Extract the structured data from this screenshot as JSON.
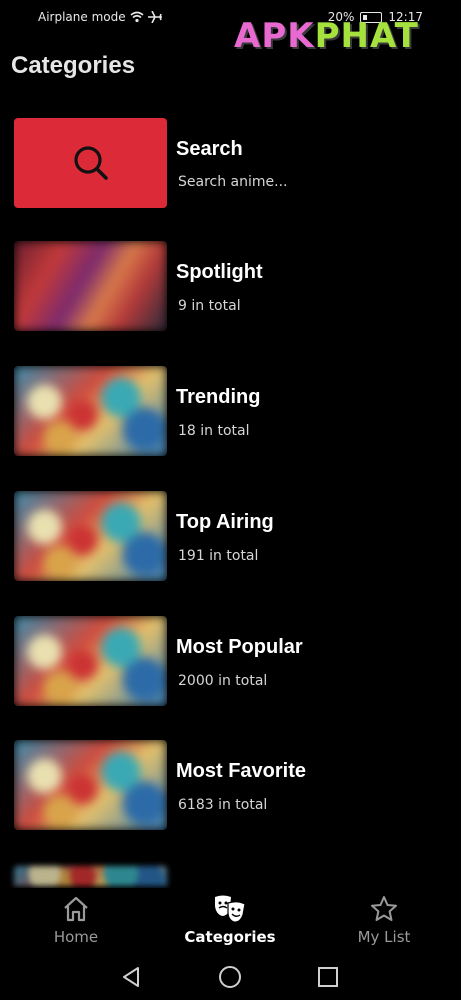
{
  "status_bar": {
    "left_text": "Airplane mode",
    "battery_percent": "20%",
    "time": "12:17"
  },
  "watermark": {
    "text_a": "APK",
    "text_b": "PHAT"
  },
  "page": {
    "title": "Categories"
  },
  "colors": {
    "background": "#000000",
    "search_tile": "#dc2a39",
    "text_primary": "#ffffff",
    "text_secondary": "#d6d6d6",
    "nav_inactive": "#9a9a9a"
  },
  "categories": [
    {
      "title": "Search",
      "subtitle": "Search anime...",
      "icon": "search-icon"
    },
    {
      "title": "Spotlight",
      "subtitle": "9 in total"
    },
    {
      "title": "Trending",
      "subtitle": "18 in total"
    },
    {
      "title": "Top Airing",
      "subtitle": "191 in total"
    },
    {
      "title": "Most Popular",
      "subtitle": "2000 in total"
    },
    {
      "title": "Most Favorite",
      "subtitle": "6183 in total"
    }
  ],
  "bottom_nav": {
    "items": [
      {
        "label": "Home",
        "icon": "home-icon",
        "active": false
      },
      {
        "label": "Categories",
        "icon": "theater-masks-icon",
        "active": true
      },
      {
        "label": "My List",
        "icon": "star-icon",
        "active": false
      }
    ]
  },
  "system_nav": {
    "back": "back-triangle-icon",
    "home": "home-circle-icon",
    "recents": "recents-square-icon"
  }
}
